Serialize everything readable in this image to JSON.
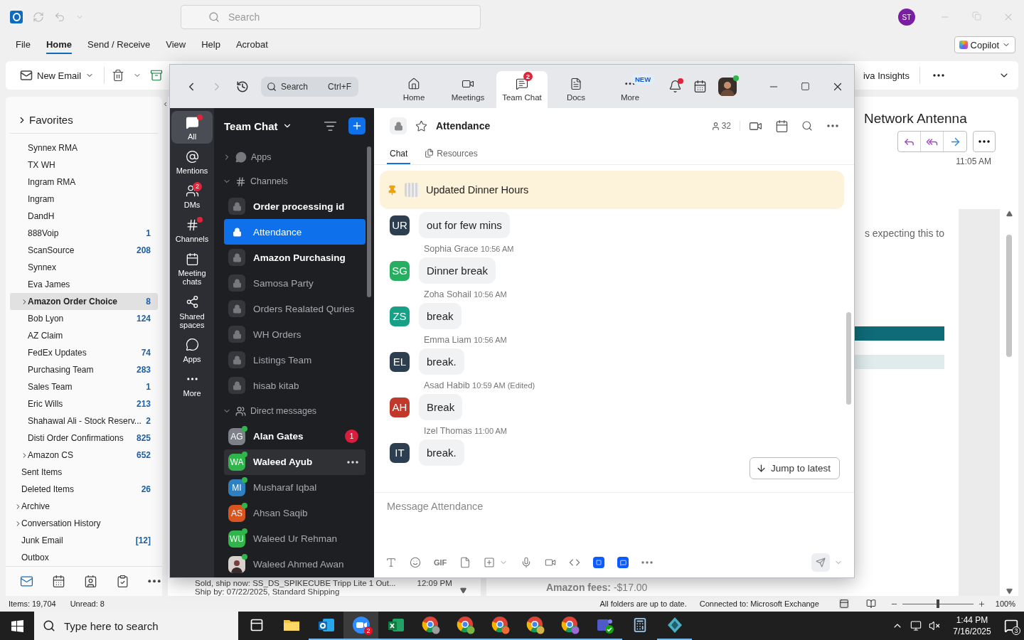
{
  "outlook": {
    "search": {
      "placeholder": "Search"
    },
    "account": {
      "initials": "ST"
    },
    "menu_tabs": [
      {
        "label": "File",
        "selected": false
      },
      {
        "label": "Home",
        "selected": true
      },
      {
        "label": "Send / Receive",
        "selected": false
      },
      {
        "label": "View",
        "selected": false
      },
      {
        "label": "Help",
        "selected": false
      },
      {
        "label": "Acrobat",
        "selected": false
      }
    ],
    "copilot": "Copilot",
    "ribbon": {
      "new_email": "New Email",
      "partial_label": "iva Insights"
    },
    "folders": {
      "heading": "Favorites",
      "items": [
        {
          "kind": "favorite",
          "name": "Synnex RMA",
          "selected": false
        },
        {
          "kind": "favorite",
          "name": "TX WH",
          "selected": false
        },
        {
          "kind": "favorite",
          "name": "Ingram RMA",
          "selected": false
        },
        {
          "kind": "favorite",
          "name": "Ingram",
          "selected": false
        },
        {
          "kind": "favorite",
          "name": "DandH",
          "selected": false
        },
        {
          "kind": "favorite",
          "name": "888Voip",
          "count": "1",
          "selected": false
        },
        {
          "kind": "favorite",
          "name": "ScanSource",
          "count": "208",
          "selected": false
        },
        {
          "kind": "favorite",
          "name": "Synnex",
          "selected": false
        },
        {
          "kind": "favorite",
          "name": "Eva James",
          "selected": false
        },
        {
          "kind": "favorite",
          "name": "Amazon Order Choice",
          "count": "8",
          "expandable": true,
          "selected": true
        },
        {
          "kind": "favorite",
          "name": "Bob Lyon",
          "count": "124",
          "selected": false
        },
        {
          "kind": "favorite",
          "name": "AZ Claim",
          "selected": false
        },
        {
          "kind": "favorite",
          "name": "FedEx Updates",
          "count": "74",
          "selected": false
        },
        {
          "kind": "favorite",
          "name": "Purchasing Team",
          "count": "283",
          "selected": false
        },
        {
          "kind": "favorite",
          "name": "Sales Team",
          "count": "1",
          "selected": false
        },
        {
          "kind": "favorite",
          "name": "Eric Wills",
          "count": "213",
          "selected": false
        },
        {
          "kind": "favorite",
          "name": "Shahawal Ali - Stock Reserv...",
          "count": "2",
          "selected": false
        },
        {
          "kind": "favorite",
          "name": "Disti Order Confirmations",
          "count": "825",
          "selected": false
        },
        {
          "kind": "favorite",
          "name": "Amazon CS",
          "count": "652",
          "expandable": true,
          "selected": false
        },
        {
          "kind": "folder",
          "name": "Sent Items",
          "selected": false
        },
        {
          "kind": "folder",
          "name": "Deleted Items",
          "count": "26",
          "selected": false
        },
        {
          "kind": "folder",
          "name": "Archive",
          "expandable": true,
          "selected": false
        },
        {
          "kind": "folder",
          "name": "Conversation History",
          "expandable": true,
          "selected": false
        },
        {
          "kind": "folder",
          "name": "Junk Email",
          "count": "[12]",
          "selected": false
        },
        {
          "kind": "folder",
          "name": "Outbox",
          "selected": false
        }
      ]
    },
    "message_list": {
      "subject": "Sold, ship now: SS_DS_SPIKECUBE Tripp Lite 1 Out...",
      "time": "12:09 PM",
      "detail": "Ship by: 07/22/2025, Standard Shipping"
    },
    "reading_pane": {
      "subject": "Network Antenna",
      "time": "11:05 AM",
      "body_fragment": "s expecting this to",
      "fees": "**Amazon fees:** -$17.00"
    },
    "status_bar": {
      "items": "Items: 19,704",
      "unread": "Unread: 8",
      "sync": "All folders are up to date.",
      "connection": "Connected to: Microsoft Exchange",
      "zoom": {
        "level": 0.5,
        "reading": "100%"
      }
    }
  },
  "zoom": {
    "search": {
      "placeholder": "Search",
      "shortcut": "Ctrl+F"
    },
    "nav_tabs": [
      {
        "kind": "home",
        "label": "Home",
        "selected": false
      },
      {
        "kind": "meetings",
        "label": "Meetings",
        "selected": false
      },
      {
        "kind": "chat",
        "label": "Team Chat",
        "selected": true,
        "badge": "2"
      },
      {
        "kind": "docs",
        "label": "Docs",
        "selected": false
      },
      {
        "kind": "more",
        "label": "More",
        "selected": false,
        "tag": "NEW"
      }
    ],
    "rail": [
      {
        "kind": "all",
        "label": "All",
        "selected": true,
        "unread": true
      },
      {
        "kind": "mentions",
        "label": "Mentions",
        "selected": false,
        "unread": false
      },
      {
        "kind": "dms",
        "label": "DMs",
        "selected": false,
        "unread": false,
        "badge": "2"
      },
      {
        "kind": "channels",
        "label": "Channels",
        "selected": false,
        "unread": true
      },
      {
        "kind": "meetings",
        "label": "Meeting chats",
        "selected": false,
        "unread": false
      },
      {
        "kind": "spaces",
        "label": "Shared spaces",
        "selected": false,
        "unread": false
      },
      {
        "kind": "apps",
        "label": "Apps",
        "selected": false,
        "unread": false
      },
      {
        "kind": "more",
        "label": "More",
        "selected": false,
        "unread": false
      }
    ],
    "list_title": "Team Chat",
    "apps_section": {
      "label": "Apps",
      "expanded": false
    },
    "channels_section": {
      "label": "Channels",
      "expanded": true,
      "channels": [
        {
          "name": "Order processing id",
          "unread": true,
          "selected": false
        },
        {
          "name": "Attendance",
          "unread": false,
          "selected": true
        },
        {
          "name": "Amazon Purchasing",
          "unread": true,
          "selected": false
        },
        {
          "name": "Samosa Party",
          "unread": false,
          "selected": false
        },
        {
          "name": "Orders Realated Quries",
          "unread": false,
          "selected": false
        },
        {
          "name": "WH Orders",
          "unread": false,
          "selected": false
        },
        {
          "name": "Listings Team",
          "unread": false,
          "selected": false
        },
        {
          "name": "hisab kitab",
          "unread": false,
          "selected": false
        }
      ]
    },
    "dm_section": {
      "label": "Direct messages",
      "expanded": true,
      "contacts": [
        {
          "kind": "initials",
          "initials": "AG",
          "name": "Alan Gates",
          "color": "#7d8087",
          "unread": true,
          "hovered": false,
          "badge": "1"
        },
        {
          "kind": "initials",
          "initials": "WA",
          "name": "Waleed Ayub",
          "color": "#2fb54a",
          "unread": true,
          "hovered": true
        },
        {
          "kind": "initials",
          "initials": "MI",
          "name": "Musharaf Iqbal",
          "color": "#2f7fc1",
          "unread": false,
          "hovered": false
        },
        {
          "kind": "initials",
          "initials": "AS",
          "name": "Ahsan Saqib",
          "color": "#d9541e",
          "unread": false,
          "hovered": false
        },
        {
          "kind": "initials",
          "initials": "WU",
          "name": "Waleed Ur Rehman",
          "color": "#2fb54a",
          "unread": false,
          "hovered": false
        },
        {
          "kind": "photo",
          "name": "Waleed Ahmed Awan",
          "unread": false,
          "hovered": false
        }
      ]
    },
    "chat": {
      "title": "Attendance",
      "members": "32",
      "tabs": [
        {
          "label": "Chat",
          "selected": true
        },
        {
          "label": "Resources",
          "selected": false
        }
      ],
      "pinned": "Updated Dinner Hours",
      "messages": [
        {
          "initials": "UR",
          "color": "#2c3e50",
          "text": "out for few mins"
        },
        {
          "sender": "Sophia Grace",
          "time": "10:56 AM",
          "initials": "SG",
          "color": "#27ae60",
          "text": "Dinner break"
        },
        {
          "sender": "Zoha Sohail",
          "time": "10:56 AM",
          "initials": "ZS",
          "color": "#16a085",
          "text": "break"
        },
        {
          "sender": "Emma Liam",
          "time": "10:56 AM",
          "initials": "EL",
          "color": "#2c3e50",
          "text": "break."
        },
        {
          "sender": "Asad Habib",
          "time": "10:59 AM",
          "edited": "(Edited)",
          "initials": "AH",
          "color": "#c0392b",
          "text": "Break"
        },
        {
          "sender": "Izel Thomas",
          "time": "11:00 AM",
          "initials": "IT",
          "color": "#2c3e50",
          "text": "break."
        }
      ],
      "jump": "Jump to latest",
      "composer": {
        "placeholder": "Message Attendance",
        "gif": "GIF"
      }
    }
  },
  "taskbar": {
    "search": {
      "placeholder": "Type here to search"
    },
    "apps": [
      {
        "kind": "task-view",
        "running": false,
        "selected": false
      },
      {
        "kind": "folder",
        "running": false,
        "selected": false
      },
      {
        "kind": "outlook",
        "running": true,
        "selected": false
      },
      {
        "kind": "zoom",
        "running": true,
        "selected": true,
        "badge": "2"
      },
      {
        "kind": "excel",
        "running": true,
        "selected": false
      },
      {
        "kind": "chrome",
        "color": "#9e9e9e",
        "running": true,
        "selected": false
      },
      {
        "kind": "chrome",
        "color": "#7cb342",
        "running": true,
        "selected": false
      },
      {
        "kind": "chrome",
        "color": "#ef6c3a",
        "running": true,
        "selected": false
      },
      {
        "kind": "chrome",
        "color": "#d4b24a",
        "running": true,
        "selected": false
      },
      {
        "kind": "chrome",
        "color": "#9b6bd1",
        "running": true,
        "selected": false
      },
      {
        "kind": "teams",
        "running": true,
        "selected": false
      },
      {
        "kind": "calculator",
        "running": false,
        "selected": false
      },
      {
        "kind": "app",
        "running": true,
        "selected": false
      }
    ],
    "time": "1:44 PM",
    "date": "7/16/2025",
    "notifications": "3"
  }
}
